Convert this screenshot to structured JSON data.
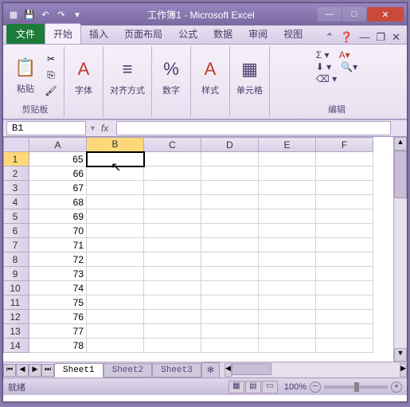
{
  "window": {
    "title": "工作簿1 - Microsoft Excel"
  },
  "tabs": {
    "file": "文件",
    "home": "开始",
    "insert": "插入",
    "layout": "页面布局",
    "formulas": "公式",
    "data": "数据",
    "review": "审阅",
    "view": "视图"
  },
  "ribbon": {
    "clipboard": {
      "label": "剪贴板",
      "paste": "粘贴"
    },
    "font": {
      "label": "字体"
    },
    "align": {
      "label": "对齐方式"
    },
    "number": {
      "label": "数字"
    },
    "style": {
      "label": "样式"
    },
    "cells": {
      "label": "单元格"
    },
    "editing": {
      "label": "编辑"
    }
  },
  "namebox": {
    "value": "B1"
  },
  "columns": [
    "A",
    "B",
    "C",
    "D",
    "E",
    "F"
  ],
  "selected_cell": "B1",
  "rows": [
    {
      "n": 1,
      "A": "65"
    },
    {
      "n": 2,
      "A": "66"
    },
    {
      "n": 3,
      "A": "67"
    },
    {
      "n": 4,
      "A": "68"
    },
    {
      "n": 5,
      "A": "69"
    },
    {
      "n": 6,
      "A": "70"
    },
    {
      "n": 7,
      "A": "71"
    },
    {
      "n": 8,
      "A": "72"
    },
    {
      "n": 9,
      "A": "73"
    },
    {
      "n": 10,
      "A": "74"
    },
    {
      "n": 11,
      "A": "75"
    },
    {
      "n": 12,
      "A": "76"
    },
    {
      "n": 13,
      "A": "77"
    },
    {
      "n": 14,
      "A": "78"
    }
  ],
  "sheets": {
    "s1": "Sheet1",
    "s2": "Sheet2",
    "s3": "Sheet3"
  },
  "status": {
    "ready": "就绪",
    "zoom": "100%"
  }
}
